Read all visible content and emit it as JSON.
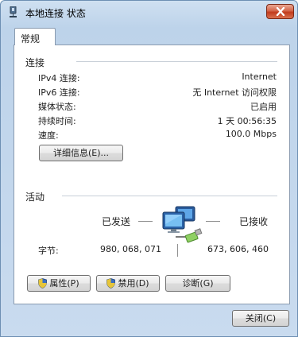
{
  "window": {
    "title": "本地连接 状态",
    "close_glyph": "✕"
  },
  "tab": {
    "label": "常规"
  },
  "connection": {
    "section_title": "连接",
    "rows": [
      {
        "label": "IPv4 连接:",
        "value": "Internet"
      },
      {
        "label": "IPv6 连接:",
        "value": "无 Internet 访问权限"
      },
      {
        "label": "媒体状态:",
        "value": "已启用"
      },
      {
        "label": "持续时间:",
        "value": "1 天 00:56:35"
      },
      {
        "label": "速度:",
        "value": "100.0 Mbps"
      }
    ],
    "details_button": "详细信息(E)..."
  },
  "activity": {
    "section_title": "活动",
    "sent_label": "已发送",
    "received_label": "已接收",
    "bytes_label": "字节:",
    "bytes_sent": "980, 068, 071",
    "bytes_received": "673, 606, 460"
  },
  "buttons": {
    "properties": "属性(P)",
    "disable": "禁用(D)",
    "diagnose": "诊断(G)",
    "close": "关闭(C)"
  },
  "icons": {
    "title": "network-adapter-icon",
    "network": "network-computers-icon",
    "shield": "uac-shield-icon"
  },
  "colors": {
    "titlebar": "#c9dbef",
    "close_button": "#c23b1c",
    "panel_border": "#8a9bb0"
  }
}
